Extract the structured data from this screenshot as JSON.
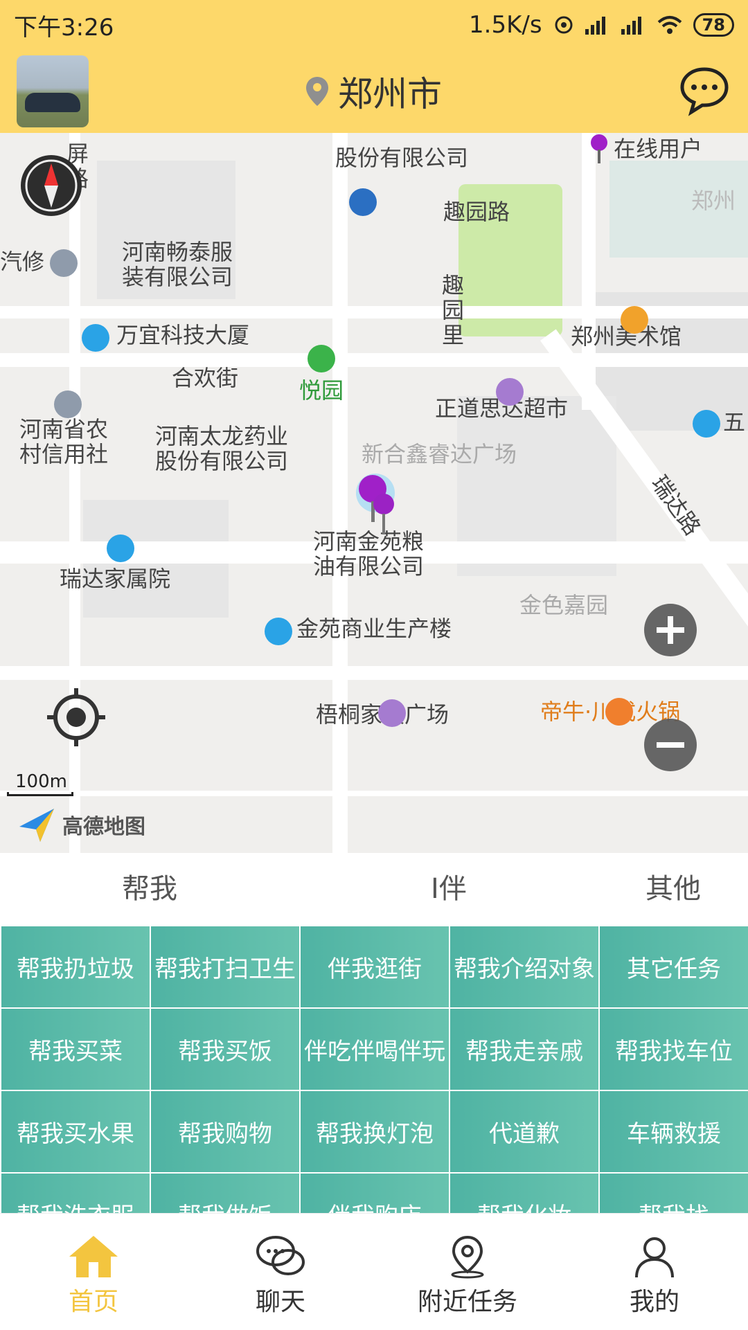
{
  "statusbar": {
    "time": "下午3:26",
    "speed": "1.5K/s",
    "battery": "78"
  },
  "header": {
    "city": "郑州市",
    "avatar_icon": "avatar-photo",
    "message_icon": "chat-bubble-icon"
  },
  "map": {
    "scale_label": "100m",
    "provider": "高德地图",
    "online_users_label": "在线用户",
    "labels": {
      "l1": "郑州",
      "l2": "股份有限公司",
      "l3": "趣园路",
      "l4": "河南畅泰服",
      "l5": "装有限公司",
      "l6": "汽修",
      "l7": "万宜科技大厦",
      "l8": "趣",
      "l9": "园",
      "l10": "里",
      "l11": "郑州美术馆",
      "l12": "合欢街",
      "l13": "悦园",
      "l14": "正道思达超市",
      "l15": "河南省农",
      "l16": "村信用社",
      "l17": "河南太龙药业",
      "l18": "股份有限公司",
      "l19": "新合鑫睿达广场",
      "l20": "瑞达路",
      "l21": "河南金苑粮",
      "l22": "油有限公司",
      "l23": "瑞达家属院",
      "l24": "金色嘉园",
      "l25": "金苑商业生产楼",
      "l26": "梧桐家具广场",
      "l27": "帝牛·川式火锅",
      "l28": "五",
      "l29": "屏",
      "l30": "路"
    }
  },
  "tabs": {
    "t1": "帮我",
    "t2": "I伴",
    "t3": "其他"
  },
  "grid": [
    [
      "帮我扔垃圾",
      "帮我打扫卫生",
      "伴我逛街",
      "帮我介绍对象",
      "其它任务"
    ],
    [
      "帮我买菜",
      "帮我买饭",
      "伴吃伴喝伴玩",
      "帮我走亲戚",
      "帮我找车位"
    ],
    [
      "帮我买水果",
      "帮我购物",
      "帮我换灯泡",
      "代道歉",
      "车辆救援"
    ],
    [
      "帮我洗衣服",
      "帮我做饭",
      "伴我购店",
      "帮我化妆",
      "帮我找"
    ]
  ],
  "nav": {
    "home": "首页",
    "chat": "聊天",
    "nearby": "附近任务",
    "mine": "我的"
  },
  "colors": {
    "header": "#fdd86a",
    "grid": "#5bbaa8",
    "active": "#f3c53f"
  }
}
